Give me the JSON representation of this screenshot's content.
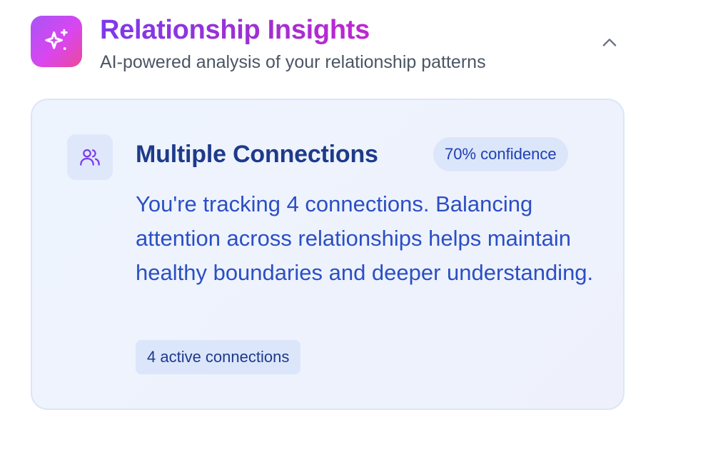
{
  "header": {
    "title": "Relationship Insights",
    "subtitle": "AI-powered analysis of your relationship patterns",
    "icon": "sparkles-icon",
    "collapse_icon": "chevron-up-icon"
  },
  "insight": {
    "icon": "users-icon",
    "title": "Multiple Connections",
    "confidence": "70% confidence",
    "body": "You're tracking 4 connections. Balancing attention across relationships helps maintain healthy boundaries and deeper understanding.",
    "tag": "4 active connections"
  },
  "colors": {
    "brand_gradient_start": "#a855f7",
    "brand_gradient_end": "#ec4899",
    "title_purple": "#7c3aed",
    "card_background": "#eef4fd",
    "card_border": "#dbe6f7",
    "card_title": "#1e3a8a",
    "card_text": "#2b4fc4",
    "badge_background": "#dce6fb"
  }
}
